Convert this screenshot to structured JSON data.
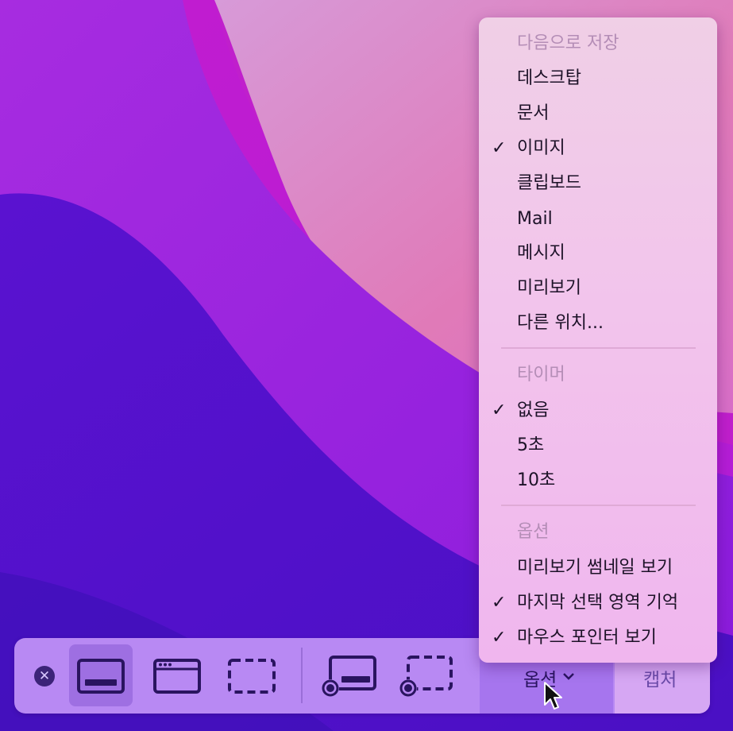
{
  "menu": {
    "save_header": "다음으로 저장",
    "save_items": [
      {
        "label": "데스크탑",
        "checked": false
      },
      {
        "label": "문서",
        "checked": false
      },
      {
        "label": "이미지",
        "checked": true
      },
      {
        "label": "클립보드",
        "checked": false
      },
      {
        "label": "Mail",
        "checked": false
      },
      {
        "label": "메시지",
        "checked": false
      },
      {
        "label": "미리보기",
        "checked": false
      },
      {
        "label": "다른 위치...",
        "checked": false
      }
    ],
    "timer_header": "타이머",
    "timer_items": [
      {
        "label": "없음",
        "checked": true
      },
      {
        "label": "5초",
        "checked": false
      },
      {
        "label": "10초",
        "checked": false
      }
    ],
    "options_header": "옵션",
    "options_items": [
      {
        "label": "미리보기 썸네일 보기",
        "checked": false
      },
      {
        "label": "마지막 선택 영역 기억",
        "checked": true
      },
      {
        "label": "마우스 포인터 보기",
        "checked": true
      }
    ],
    "check_glyph": "✓"
  },
  "toolbar": {
    "close_glyph": "✕",
    "options_label": "옵션",
    "capture_label": "캡처",
    "selected_tool": "capture-entire-screen"
  },
  "colors": {
    "accent": "#9e6fe2",
    "toolbar_bg": "#b889f3",
    "icon": "#2a1460"
  }
}
